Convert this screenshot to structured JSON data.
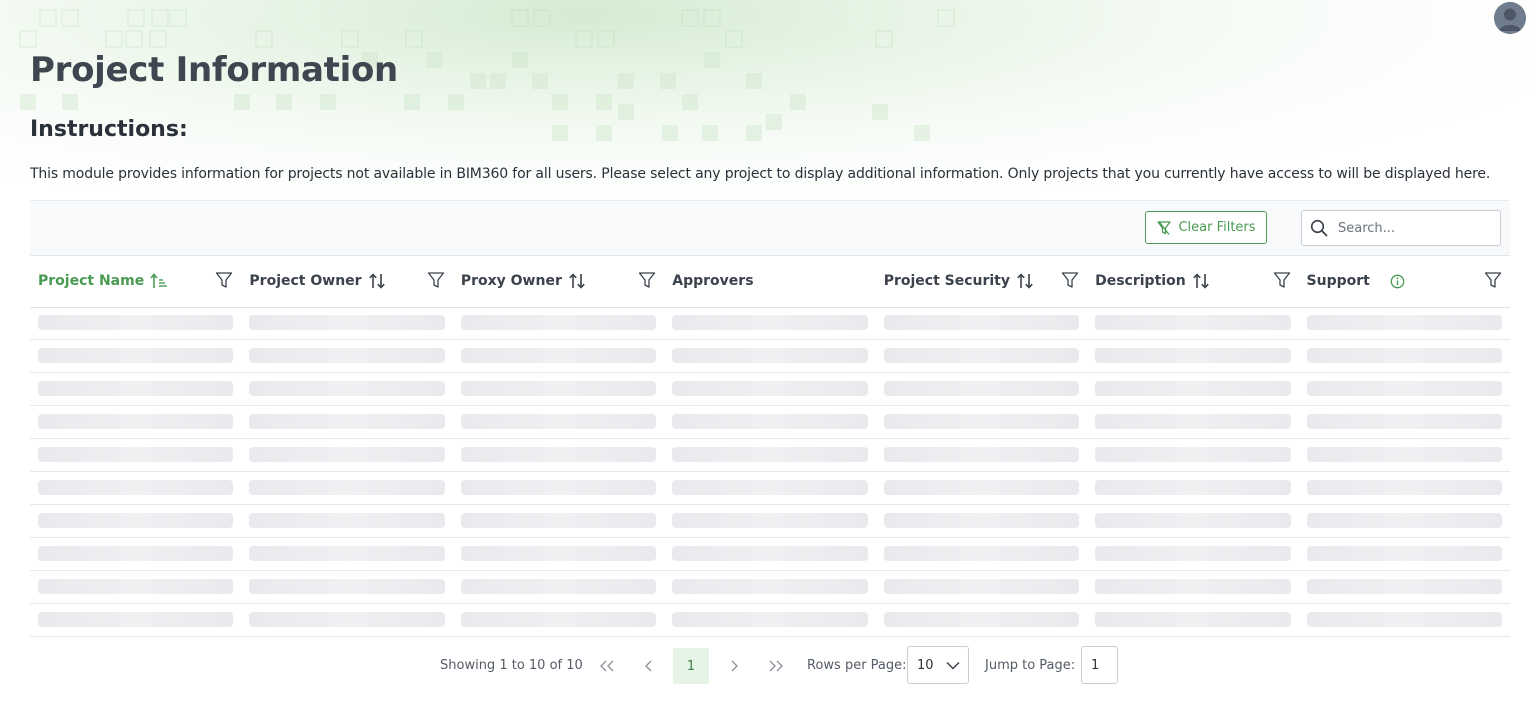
{
  "header": {
    "page_title": "Project Information",
    "instructions_heading": "Instructions:",
    "instructions_text": "This module provides information for projects not available in BIM360 for all users. Please select any project to display additional information. Only projects that you currently have access to will be displayed here."
  },
  "toolbar": {
    "clear_filters_label": "Clear Filters",
    "search_placeholder": "Search..."
  },
  "table": {
    "columns": [
      {
        "label": "Project Name",
        "sorted": "ascending"
      },
      {
        "label": "Project Owner"
      },
      {
        "label": "Proxy Owner"
      },
      {
        "label": "Approvers"
      },
      {
        "label": "Project Security"
      },
      {
        "label": "Description"
      },
      {
        "label": "Support",
        "info_icon": true
      }
    ],
    "loading_rows": 10
  },
  "pagination": {
    "showing_text": "Showing 1 to 10 of 10",
    "first_label": "<<",
    "prev_label": "<",
    "current_page": "1",
    "next_label": ">",
    "last_label": ">>",
    "rows_per_page_label": "Rows per Page:",
    "rows_per_page_value": "10",
    "jump_label": "Jump to Page:",
    "jump_value": "1"
  },
  "colors": {
    "accent": "#4a9b52",
    "title": "#3f4650",
    "skeleton": "#e8eaed"
  },
  "icons": [
    "user-avatar-icon",
    "filter-clear-icon",
    "search-icon",
    "sort-asc-icon",
    "sort-icon",
    "filter-icon",
    "info-icon",
    "chevron-down-icon"
  ]
}
